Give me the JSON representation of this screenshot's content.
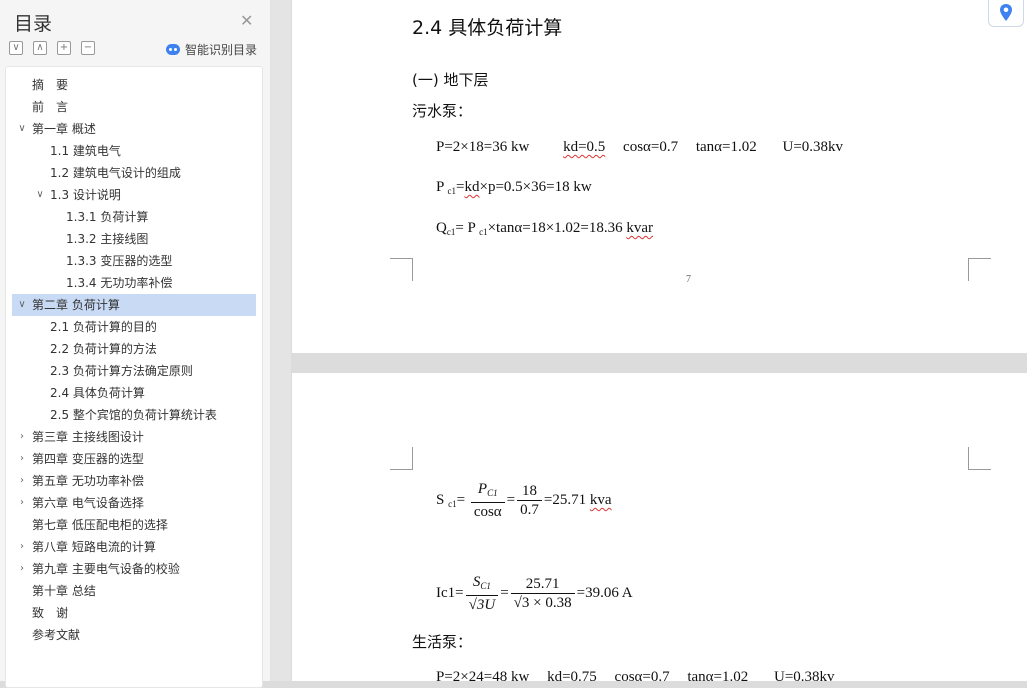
{
  "sidebar": {
    "title": "目录",
    "ai_label": "智能识别目录",
    "tools": [
      "∨",
      "∧",
      "+",
      "−"
    ],
    "items": [
      {
        "label": "摘　要",
        "level": 0,
        "arrow": ""
      },
      {
        "label": "前　言",
        "level": 0,
        "arrow": ""
      },
      {
        "label": "第一章 概述",
        "level": 0,
        "arrow": "∨"
      },
      {
        "label": "1.1 建筑电气",
        "level": 1,
        "arrow": ""
      },
      {
        "label": "1.2 建筑电气设计的组成",
        "level": 1,
        "arrow": ""
      },
      {
        "label": "1.3 设计说明",
        "level": 1,
        "arrow": "∨"
      },
      {
        "label": "1.3.1 负荷计算",
        "level": 2,
        "arrow": ""
      },
      {
        "label": "1.3.2 主接线图",
        "level": 2,
        "arrow": ""
      },
      {
        "label": "1.3.3 变压器的选型",
        "level": 2,
        "arrow": ""
      },
      {
        "label": "1.3.4 无功功率补偿",
        "level": 2,
        "arrow": ""
      },
      {
        "label": "第二章 负荷计算",
        "level": 0,
        "arrow": "∨",
        "active": true
      },
      {
        "label": "2.1 负荷计算的目的",
        "level": 1,
        "arrow": ""
      },
      {
        "label": "2.2 负荷计算的方法",
        "level": 1,
        "arrow": ""
      },
      {
        "label": "2.3 负荷计算方法确定原则",
        "level": 1,
        "arrow": ""
      },
      {
        "label": "2.4 具体负荷计算",
        "level": 1,
        "arrow": ""
      },
      {
        "label": "2.5  整个宾馆的负荷计算统计表",
        "level": 1,
        "arrow": ""
      },
      {
        "label": "第三章 主接线图设计",
        "level": 0,
        "arrow": "›"
      },
      {
        "label": "第四章 变压器的选型",
        "level": 0,
        "arrow": "›"
      },
      {
        "label": "第五章 无功功率补偿",
        "level": 0,
        "arrow": "›"
      },
      {
        "label": "第六章 电气设备选择",
        "level": 0,
        "arrow": "›"
      },
      {
        "label": "第七章 低压配电柜的选择",
        "level": 0,
        "arrow": ""
      },
      {
        "label": "第八章 短路电流的计算",
        "level": 0,
        "arrow": "›"
      },
      {
        "label": "第九章 主要电气设备的校验",
        "level": 0,
        "arrow": "›"
      },
      {
        "label": "第十章 总结",
        "level": 0,
        "arrow": ""
      },
      {
        "label": "致　谢",
        "level": 0,
        "arrow": ""
      },
      {
        "label": "参考文献",
        "level": 0,
        "arrow": ""
      }
    ]
  },
  "doc": {
    "heading": "2.4 具体负荷计算",
    "section": "(一) 地下层",
    "pump1_label": "污水泵：",
    "pump1_line1": "P=2×18=36 kw",
    "pump1_kd": "kd=0.5",
    "pump1_cos": "cosα=0.7",
    "pump1_tan": "tanα=1.02",
    "pump1_u": "U=0.38kv",
    "pc1_prefix": "P",
    "pc1_sub": "c1",
    "pc1_eq": "=",
    "pc1_kd": "kd",
    "pc1_rest": "×p=0.5×36=18 kw",
    "qc1_prefix": "Q",
    "qc1_sub": "c1",
    "qc1_mid": "= P",
    "qc1_sub2": "c1",
    "qc1_rest": "×tanα=18×1.02=18.36 ",
    "qc1_unit": "kvar",
    "page_number": "7",
    "sc1_prefix": "S",
    "sc1_sub": "c1",
    "sc1_eq": "=",
    "sc1_num": "P",
    "sc1_num_sub": "C1",
    "sc1_den": "cosα",
    "sc1_eq2": "=",
    "sc1_num2": "18",
    "sc1_den2": "0.7",
    "sc1_result": "=25.71 ",
    "sc1_unit": "kva",
    "ic1_prefix": "Ic1=",
    "ic1_num": "S",
    "ic1_num_sub": "C1",
    "ic1_den": "√3U",
    "ic1_eq": "=",
    "ic1_num2": "25.71",
    "ic1_den2": "√3 × 0.38",
    "ic1_result": "=39.06 A",
    "pump2_label": "生活泵：",
    "pump2_line1": "P=2×24=48 kw",
    "pump2_kd": "kd=0.75",
    "pump2_cos": "cosα=0.7",
    "pump2_tan": "tanα=1.02",
    "pump2_u": "U=0.38kv"
  },
  "colors": {
    "accent": "#3d82f0",
    "active_row": "#c9daf5"
  }
}
